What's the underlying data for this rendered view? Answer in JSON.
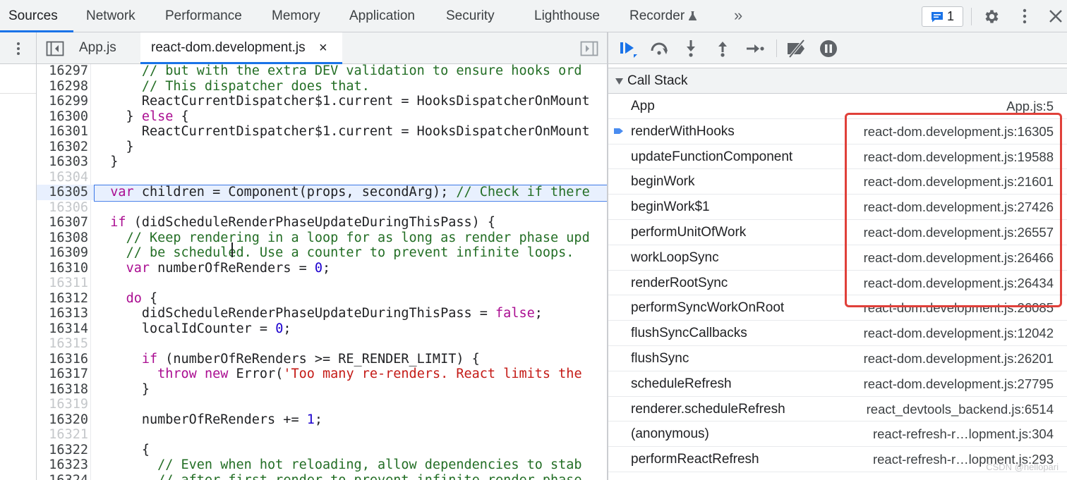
{
  "top_tabs": [
    "Sources",
    "Network",
    "Performance",
    "Memory",
    "Application",
    "Security",
    "Lighthouse",
    "Recorder"
  ],
  "more_tabs_label": "»",
  "issues_count": "1",
  "icons": {
    "recorder": "flask-icon",
    "issues": "message-icon",
    "settings": "gear-icon",
    "more": "kebab-icon",
    "close": "close-icon",
    "navigator": "toggle-navigator-icon",
    "debugger": "toggle-debugger-icon",
    "resume": "resume-icon",
    "step_over": "step-over-icon",
    "step_into": "step-into-icon",
    "step_out": "step-out-icon",
    "step": "step-icon",
    "deactivate_breakpoints": "deactivate-breakpoints-icon",
    "pause_on_exceptions": "pause-on-exceptions-icon"
  },
  "colors": {
    "accent": "#1a73e8",
    "comment": "#236e25",
    "keyword": "#aa0d91",
    "number": "#1c00cf",
    "string": "#c41a16",
    "highlight_box": "#e0403a"
  },
  "file_tabs": [
    "App.js",
    "react-dom.development.js"
  ],
  "file_tab_close": "×",
  "code": {
    "current_line": "16305",
    "lines": [
      {
        "n": "16297",
        "faded": false,
        "tokens": [
          [
            "      ",
            ""
          ],
          [
            "// but with the extra DEV validation to ensure hooks ord",
            "cm"
          ]
        ]
      },
      {
        "n": "16298",
        "faded": false,
        "tokens": [
          [
            "      ",
            ""
          ],
          [
            "// This dispatcher does that.",
            "cm"
          ]
        ]
      },
      {
        "n": "16299",
        "faded": false,
        "tokens": [
          [
            "      ReactCurrentDispatcher$1.current = HooksDispatcherOnMount",
            ""
          ]
        ]
      },
      {
        "n": "16300",
        "faded": false,
        "tokens": [
          [
            "    } ",
            ""
          ],
          [
            "else",
            "kw"
          ],
          [
            " {",
            ""
          ]
        ]
      },
      {
        "n": "16301",
        "faded": false,
        "tokens": [
          [
            "      ReactCurrentDispatcher$1.current = HooksDispatcherOnMount",
            ""
          ]
        ]
      },
      {
        "n": "16302",
        "faded": false,
        "tokens": [
          [
            "    }",
            ""
          ]
        ]
      },
      {
        "n": "16303",
        "faded": false,
        "tokens": [
          [
            "  }",
            ""
          ]
        ]
      },
      {
        "n": "16304",
        "faded": true,
        "tokens": [
          [
            "",
            ""
          ]
        ]
      },
      {
        "n": "16305",
        "faded": false,
        "tokens": [
          [
            "  ",
            ""
          ],
          [
            "var",
            "kw"
          ],
          [
            " children = Component(props, secondArg); ",
            ""
          ],
          [
            "// Check if there",
            "cm"
          ]
        ]
      },
      {
        "n": "16306",
        "faded": true,
        "tokens": [
          [
            "",
            ""
          ]
        ]
      },
      {
        "n": "16307",
        "faded": false,
        "tokens": [
          [
            "  ",
            ""
          ],
          [
            "if",
            "kw"
          ],
          [
            " (didScheduleRenderPhaseUpdateDuringThisPass) {",
            ""
          ]
        ]
      },
      {
        "n": "16308",
        "faded": false,
        "tokens": [
          [
            "    ",
            ""
          ],
          [
            "// Keep rendering in a loop for as long as render phase upd",
            "cm"
          ]
        ]
      },
      {
        "n": "16309",
        "faded": false,
        "tokens": [
          [
            "    ",
            ""
          ],
          [
            "// be scheduled. Use a counter to prevent infinite loops.",
            "cm"
          ]
        ]
      },
      {
        "n": "16310",
        "faded": false,
        "tokens": [
          [
            "    ",
            ""
          ],
          [
            "var",
            "kw"
          ],
          [
            " numberOfReRenders = ",
            ""
          ],
          [
            "0",
            "nu"
          ],
          [
            ";",
            ""
          ]
        ]
      },
      {
        "n": "16311",
        "faded": true,
        "tokens": [
          [
            "",
            ""
          ]
        ]
      },
      {
        "n": "16312",
        "faded": false,
        "tokens": [
          [
            "    ",
            ""
          ],
          [
            "do",
            "kw"
          ],
          [
            " {",
            ""
          ]
        ]
      },
      {
        "n": "16313",
        "faded": false,
        "tokens": [
          [
            "      didScheduleRenderPhaseUpdateDuringThisPass = ",
            ""
          ],
          [
            "false",
            "kw"
          ],
          [
            ";",
            ""
          ]
        ]
      },
      {
        "n": "16314",
        "faded": false,
        "tokens": [
          [
            "      localIdCounter = ",
            ""
          ],
          [
            "0",
            "nu"
          ],
          [
            ";",
            ""
          ]
        ]
      },
      {
        "n": "16315",
        "faded": true,
        "tokens": [
          [
            "",
            ""
          ]
        ]
      },
      {
        "n": "16316",
        "faded": false,
        "tokens": [
          [
            "      ",
            ""
          ],
          [
            "if",
            "kw"
          ],
          [
            " (numberOfReRenders >= RE_RENDER_LIMIT) {",
            ""
          ]
        ]
      },
      {
        "n": "16317",
        "faded": false,
        "tokens": [
          [
            "        ",
            ""
          ],
          [
            "throw",
            "kw"
          ],
          [
            " ",
            ""
          ],
          [
            "new",
            "kw"
          ],
          [
            " Error(",
            ""
          ],
          [
            "'Too many re-renders. React limits the",
            "st"
          ]
        ]
      },
      {
        "n": "16318",
        "faded": false,
        "tokens": [
          [
            "      }",
            ""
          ]
        ]
      },
      {
        "n": "16319",
        "faded": true,
        "tokens": [
          [
            "",
            ""
          ]
        ]
      },
      {
        "n": "16320",
        "faded": false,
        "tokens": [
          [
            "      numberOfReRenders += ",
            ""
          ],
          [
            "1",
            "nu"
          ],
          [
            ";",
            ""
          ]
        ]
      },
      {
        "n": "16321",
        "faded": true,
        "tokens": [
          [
            "",
            ""
          ]
        ]
      },
      {
        "n": "16322",
        "faded": false,
        "tokens": [
          [
            "      {",
            ""
          ]
        ]
      },
      {
        "n": "16323",
        "faded": false,
        "tokens": [
          [
            "        ",
            ""
          ],
          [
            "// Even when hot reloading, allow dependencies to stab",
            "cm"
          ]
        ]
      },
      {
        "n": "16324",
        "faded": false,
        "tokens": [
          [
            "        ",
            ""
          ],
          [
            "// after first render to prevent infinite render phase",
            "cm"
          ]
        ]
      }
    ]
  },
  "call_stack": {
    "title": "Call Stack",
    "frames": [
      {
        "name": "App",
        "location": "App.js:5",
        "current": false
      },
      {
        "name": "renderWithHooks",
        "location": "react-dom.development.js:16305",
        "current": true
      },
      {
        "name": "updateFunctionComponent",
        "location": "react-dom.development.js:19588",
        "current": false
      },
      {
        "name": "beginWork",
        "location": "react-dom.development.js:21601",
        "current": false
      },
      {
        "name": "beginWork$1",
        "location": "react-dom.development.js:27426",
        "current": false
      },
      {
        "name": "performUnitOfWork",
        "location": "react-dom.development.js:26557",
        "current": false
      },
      {
        "name": "workLoopSync",
        "location": "react-dom.development.js:26466",
        "current": false
      },
      {
        "name": "renderRootSync",
        "location": "react-dom.development.js:26434",
        "current": false
      },
      {
        "name": "performSyncWorkOnRoot",
        "location": "react-dom.development.js:26085",
        "current": false
      },
      {
        "name": "flushSyncCallbacks",
        "location": "react-dom.development.js:12042",
        "current": false
      },
      {
        "name": "flushSync",
        "location": "react-dom.development.js:26201",
        "current": false
      },
      {
        "name": "scheduleRefresh",
        "location": "react-dom.development.js:27795",
        "current": false
      },
      {
        "name": "renderer.scheduleRefresh",
        "location": "react_devtools_backend.js:6514",
        "current": false
      },
      {
        "name": "(anonymous)",
        "location": "react-refresh-r…lopment.js:304",
        "current": false
      },
      {
        "name": "performReactRefresh",
        "location": "react-refresh-r…lopment.js:293",
        "current": false
      }
    ]
  },
  "watermark": "CSDN @hellopari"
}
